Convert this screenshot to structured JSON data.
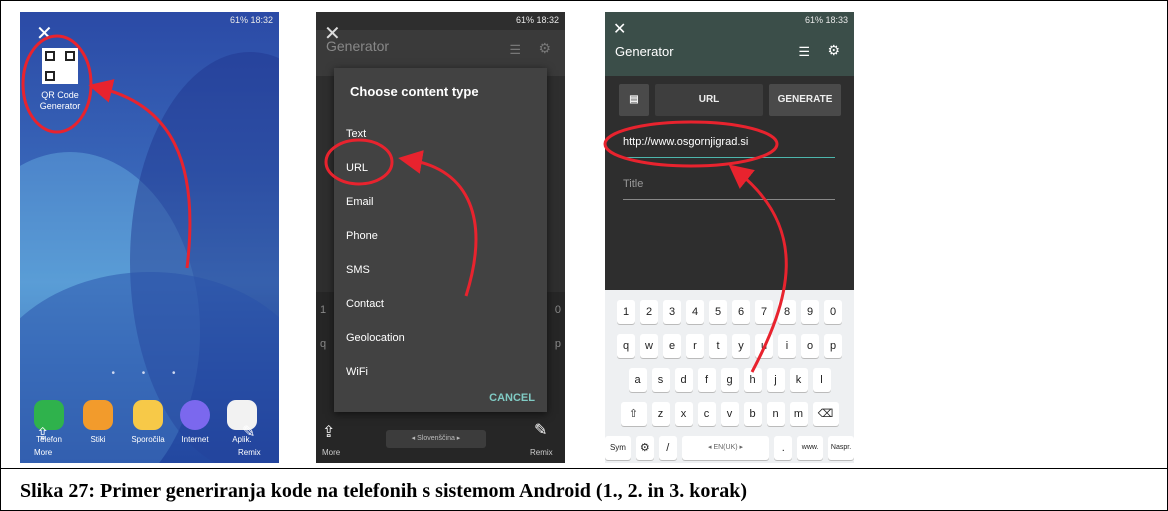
{
  "caption": "Slika 27: Primer generiranja kode na telefonih s sistemom Android (1., 2. in 3. korak)",
  "status": {
    "phone1": "61% 18:32",
    "phone2": "61% 18:32",
    "phone3": "61% 18:33"
  },
  "phone1": {
    "close_glyph": "✕",
    "app_label_line1": "QR Code",
    "app_label_line2": "Generator",
    "page_dots": "• • •",
    "dock": [
      "Telefon",
      "Stiki",
      "Sporočila",
      "Internet",
      "Aplik."
    ],
    "more_label": "More",
    "remix_label": "Remix"
  },
  "phone2": {
    "title": "Generator",
    "dialog_title": "Choose content type",
    "items": [
      "Text",
      "URL",
      "Email",
      "Phone",
      "SMS",
      "Contact",
      "Geolocation",
      "WiFi"
    ],
    "cancel": "CANCEL",
    "keyboard_lang": "◂ Slovenščina ▸",
    "more_label": "More",
    "remix_label": "Remix"
  },
  "phone3": {
    "title": "Generator",
    "url_tab": "URL",
    "generate": "GENERATE",
    "url_value": "http://www.osgornjigrad.si",
    "title_placeholder": "Title",
    "row_numbers": [
      "1",
      "2",
      "3",
      "4",
      "5",
      "6",
      "7",
      "8",
      "9",
      "0"
    ],
    "row_q": [
      "q",
      "w",
      "e",
      "r",
      "t",
      "y",
      "u",
      "i",
      "o",
      "p"
    ],
    "row_a": [
      "a",
      "s",
      "d",
      "f",
      "g",
      "h",
      "j",
      "k",
      "l"
    ],
    "row_z": [
      "z",
      "x",
      "c",
      "v",
      "b",
      "n",
      "m"
    ],
    "sym": "Sym",
    "slash": "/",
    "space_label": "◂ EN(UK) ▸",
    "dot": ".",
    "www": "www.",
    "next": "Naspr."
  },
  "colors": {
    "annotation_red": "#e8232e",
    "accent_teal": "#4db6ac"
  },
  "icons": {
    "close": "close-icon",
    "list": "list-icon",
    "settings": "gear-icon",
    "share": "share-icon",
    "pen": "pen-icon"
  }
}
